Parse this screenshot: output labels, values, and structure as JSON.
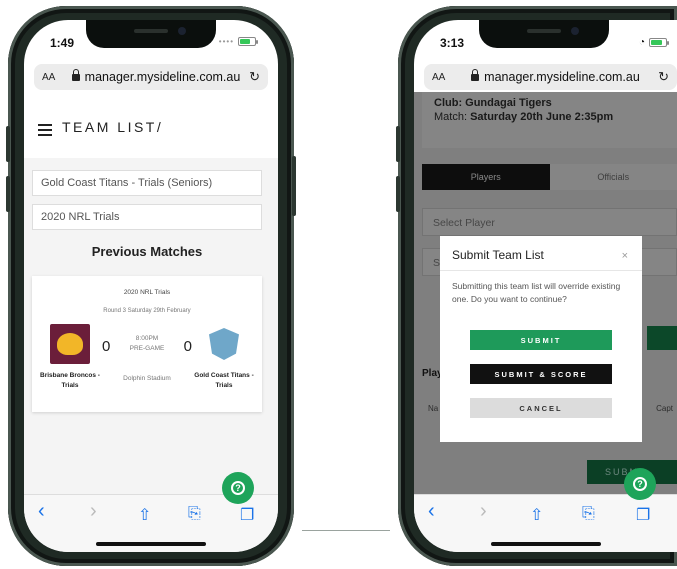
{
  "left_phone": {
    "status_time": "1:49",
    "url": "manager.mysideline.com.au",
    "url_aa": "AA",
    "page_title": "TEAM LIST/",
    "team_select": "Gold Coast Titans - Trials (Seniors)",
    "competition_select": "2020 NRL Trials",
    "section_title": "Previous Matches",
    "match": {
      "competition": "2020 NRL Trials",
      "round": "Round 3 Saturday 29th February",
      "home_team": "Brisbane Broncos - Trials",
      "home_score": "0",
      "away_team": "Gold Coast Titans - Trials",
      "away_score": "0",
      "time": "8:00PM",
      "status": "PRE-GAME",
      "venue": "Dolphin Stadium"
    },
    "help_icon": "question-circle-icon"
  },
  "right_phone": {
    "status_time": "3:13",
    "url": "manager.mysideline.com.au",
    "url_aa": "AA",
    "club_line": "Club: Gundagai Tigers",
    "match_label": "Match:",
    "match_value": "Saturday 20th June 2:35pm",
    "tabs": [
      "Players",
      "Officials"
    ],
    "select_player_placeholder": "Select Player",
    "select_partial": "Se",
    "players_label_partial": "Play",
    "na_label_partial": "Na",
    "capt_label_partial": "Capt",
    "bottom_submit_partial": "SUBM",
    "modal": {
      "title": "Submit Team List",
      "close": "×",
      "body": "Submitting this team list will override existing one. Do you want to continue?",
      "submit_label": "SUBMIT",
      "submit_score_label": "SUBMIT & SCORE",
      "cancel_label": "CANCEL"
    },
    "help_icon": "question-circle-icon"
  },
  "browser_nav": {
    "back": "‹",
    "forward": "›",
    "share": "⇧",
    "bookmarks": "⎘",
    "tabs": "❐",
    "reload": "↻"
  },
  "colors": {
    "accent_green": "#1e9a5a",
    "broncos_maroon": "#6b1e3a",
    "titans_blue": "#6fa7c9"
  }
}
